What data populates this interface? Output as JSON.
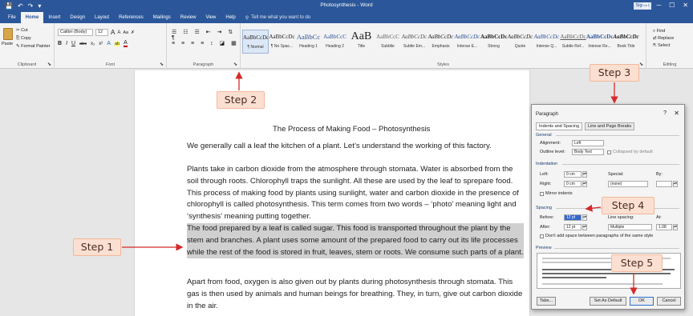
{
  "titlebar": {
    "quick_access": [
      "💾",
      "↶",
      "↷",
      "▾"
    ],
    "window_title": "Photosynthesis - Word",
    "sign_in": "Sign in",
    "controls": [
      "🗖",
      "─",
      "☐",
      "✕"
    ]
  },
  "ribbon_tabs": [
    "File",
    "Home",
    "Insert",
    "Design",
    "Layout",
    "References",
    "Mailings",
    "Review",
    "View",
    "Help"
  ],
  "tell_me": "Tell me what you want to do",
  "clipboard": {
    "paste": "Paste",
    "cut": "Cut",
    "copy": "Copy",
    "format_painter": "Format Painter",
    "label": "Clipboard"
  },
  "font": {
    "name": "Calibri (Body)",
    "size": "12",
    "grow": "A",
    "shrink": "A",
    "case": "Aa",
    "clear": "✗",
    "bold": "B",
    "italic": "I",
    "underline": "U",
    "strike": "abc",
    "sub": "x₂",
    "sup": "x²",
    "effects": "A",
    "highlight": "ab",
    "color": "A",
    "label": "Font"
  },
  "paragraph": {
    "label": "Paragraph"
  },
  "styles": {
    "items": [
      {
        "sample": "AaBbCcDc",
        "name": "¶ Normal"
      },
      {
        "sample": "AaBbCcDc",
        "name": "¶ No Spac..."
      },
      {
        "sample": "AaBbCc",
        "name": "Heading 1"
      },
      {
        "sample": "AaBbCcC",
        "name": "Heading 2"
      },
      {
        "sample": "AaB",
        "name": "Title"
      },
      {
        "sample": "AaBbCcC",
        "name": "Subtitle"
      },
      {
        "sample": "AaBbCcDc",
        "name": "Subtle Em..."
      },
      {
        "sample": "AaBbCcDc",
        "name": "Emphasis"
      },
      {
        "sample": "AaBbCcDc",
        "name": "Intense E..."
      },
      {
        "sample": "AaBbCcDc",
        "name": "Strong"
      },
      {
        "sample": "AaBbCcDc",
        "name": "Quote"
      },
      {
        "sample": "AaBbCcDc",
        "name": "Intense Q..."
      },
      {
        "sample": "AaBbCcDc",
        "name": "Subtle Ref..."
      },
      {
        "sample": "AaBbCcDc",
        "name": "Intense Re..."
      },
      {
        "sample": "AaBbCcDc",
        "name": "Book Title"
      }
    ],
    "label": "Styles"
  },
  "editing": {
    "find": "Find",
    "replace": "Replace",
    "select": "Select",
    "label": "Editing"
  },
  "document": {
    "title": "The Process of Making Food – Photosynthesis",
    "paragraphs": [
      "We generally call a leaf the kitchen of a plant. Let’s understand the working of this factory.",
      "Plants take in carbon dioxide from the atmosphere through stomata. Water is absorbed from the soil through roots. Chlorophyll traps the sunlight. All these are used by the leaf to sprepare food. This process of making food by plants using sunlight, water and carbon dioxide in the presence of chlorophyll is called photosynthesis. This term comes from two words – ‘photo’ meaning light and ‘synthesis’ meaning putting together.",
      "The food prepared by a leaf is called sugar. This food is transported throughout the plant by the stem and branches. A plant uses some amount of the prepared food to carry out its life processes while the rest of the food is stored in fruit, leaves, stem or roots. We consume such parts of a plant.",
      "Apart from food, oxygen is also given out by plants during photosynthesis through stomata. This gas is then used by animals and human beings for breathing. They, in turn, give out carbon dioxide in the air."
    ]
  },
  "dialog": {
    "title": "Paragraph",
    "help": "?",
    "close": "✕",
    "tabs": [
      "Indents and Spacing",
      "Line and Page Breaks"
    ],
    "general": "General",
    "alignment_label": "Alignment:",
    "alignment_value": "Left",
    "outline_label": "Outline level:",
    "outline_value": "Body Text",
    "collapsed": "Collapsed by default",
    "indentation": "Indentation",
    "left_label": "Left:",
    "left_value": "0 cm",
    "right_label": "Right:",
    "right_value": "0 cm",
    "special_label": "Special:",
    "special_value": "(none)",
    "by_label": "By:",
    "mirror": "Mirror indents",
    "spacing": "Spacing",
    "before_label": "Before:",
    "before_value": "12 pt",
    "after_label": "After:",
    "after_value": "12 pt",
    "line_spacing_label": "Line spacing:",
    "line_spacing_value": "Multiple",
    "at_label": "At:",
    "at_value": "1.08",
    "dont_add": "Don't add space between paragraphs of the same style",
    "preview": "Preview",
    "tabs_btn": "Tabs...",
    "default_btn": "Set As Default",
    "ok_btn": "OK",
    "cancel_btn": "Cancel"
  },
  "steps": [
    "Step 1",
    "Step 2",
    "Step 3",
    "Step 4",
    "Step 5"
  ],
  "colors": {
    "word_blue": "#2b579a",
    "step_fill": "#fbe0d2",
    "arrow_red": "#d42a2a",
    "selection": "#d0d0d0"
  }
}
